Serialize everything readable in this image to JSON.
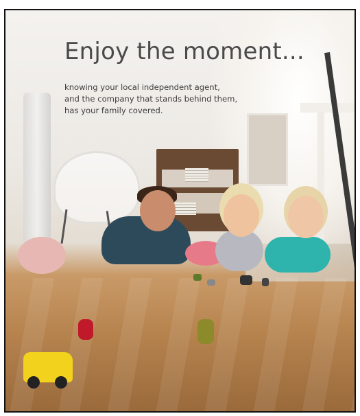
{
  "hero": {
    "headline": "Enjoy the moment...",
    "subtext_lines": [
      "knowing your local independent agent,",
      "and the company that stands behind them,",
      "has your family covered."
    ]
  }
}
